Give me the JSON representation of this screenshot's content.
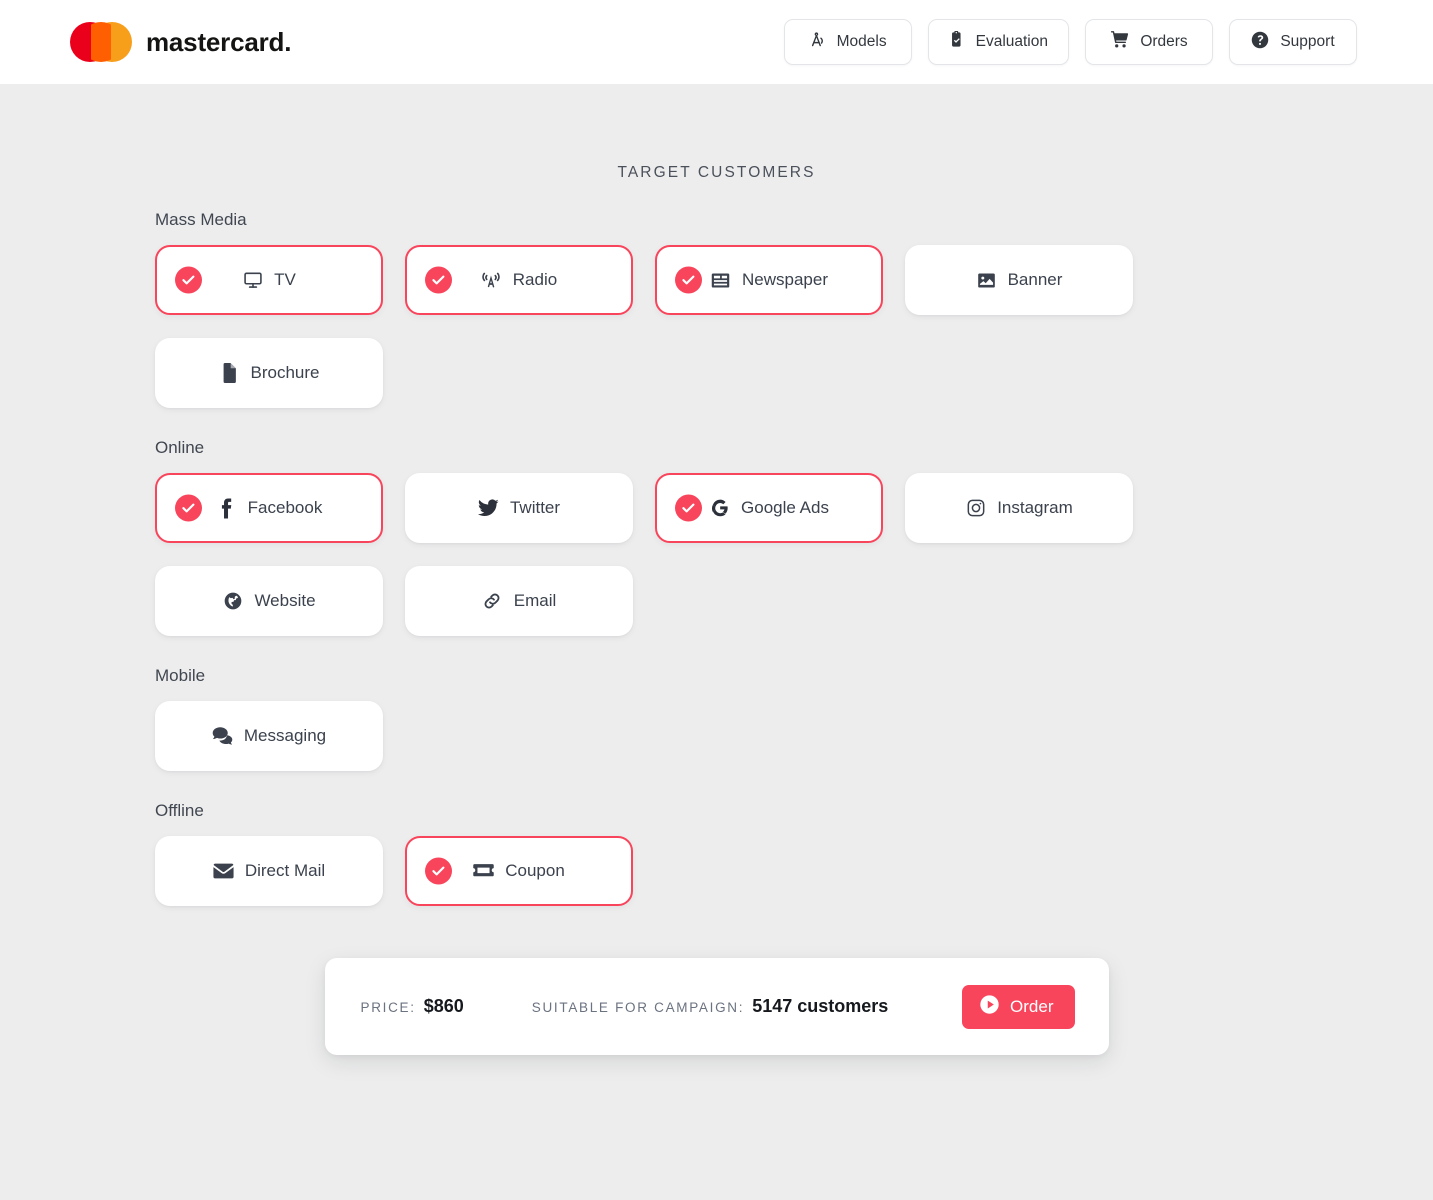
{
  "brand": {
    "name": "mastercard",
    "suffix": "."
  },
  "nav": {
    "items": [
      {
        "label": "Models",
        "icon": "drafting-compass-icon"
      },
      {
        "label": "Evaluation",
        "icon": "clipboard-check-icon"
      },
      {
        "label": "Orders",
        "icon": "shopping-cart-icon"
      },
      {
        "label": "Support",
        "icon": "question-circle-icon"
      }
    ]
  },
  "main": {
    "title": "TARGET CUSTOMERS",
    "sections": [
      {
        "label": "Mass Media",
        "cards": [
          {
            "label": "TV",
            "icon": "tv-icon",
            "selected": true
          },
          {
            "label": "Radio",
            "icon": "broadcast-tower-icon",
            "selected": true
          },
          {
            "label": "Newspaper",
            "icon": "newspaper-icon",
            "selected": true
          },
          {
            "label": "Banner",
            "icon": "image-icon",
            "selected": false
          },
          {
            "label": "Brochure",
            "icon": "file-icon",
            "selected": false
          }
        ]
      },
      {
        "label": "Online",
        "cards": [
          {
            "label": "Facebook",
            "icon": "facebook-icon",
            "selected": true
          },
          {
            "label": "Twitter",
            "icon": "twitter-icon",
            "selected": false
          },
          {
            "label": "Google Ads",
            "icon": "google-icon",
            "selected": true
          },
          {
            "label": "Instagram",
            "icon": "instagram-icon",
            "selected": false
          },
          {
            "label": "Website",
            "icon": "globe-icon",
            "selected": false
          },
          {
            "label": "Email",
            "icon": "link-icon",
            "selected": false
          }
        ]
      },
      {
        "label": "Mobile",
        "cards": [
          {
            "label": "Messaging",
            "icon": "comments-icon",
            "selected": false
          }
        ]
      },
      {
        "label": "Offline",
        "cards": [
          {
            "label": "Direct Mail",
            "icon": "envelope-icon",
            "selected": false
          },
          {
            "label": "Coupon",
            "icon": "ticket-icon",
            "selected": true
          }
        ]
      }
    ]
  },
  "summary": {
    "price_key": "PRICE:",
    "price_value": "$860",
    "audience_key": "SUITABLE FOR CAMPAIGN:",
    "audience_value": "5147 customers",
    "order_label": "Order",
    "order_icon": "play-circle-icon"
  },
  "colors": {
    "accent": "#f8455c",
    "background": "#ededed",
    "card": "#ffffff",
    "text": "#3b424d",
    "brand_red": "#eb001b",
    "brand_yellow": "#f79e1b",
    "brand_orange": "#ff5f00"
  }
}
